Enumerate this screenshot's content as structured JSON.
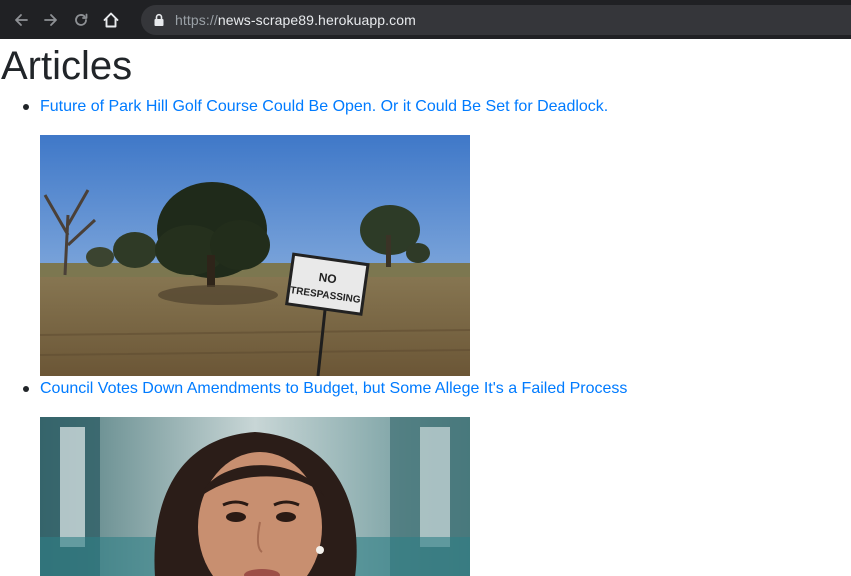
{
  "browser": {
    "url_scheme": "https://",
    "url_host": "news-scrape89.herokuapp.com",
    "icons": [
      "arrow-left-icon",
      "arrow-right-icon",
      "reload-icon",
      "home-icon",
      "lock-icon"
    ]
  },
  "page": {
    "heading": "Articles",
    "articles": [
      {
        "title": "Future of Park Hill Golf Course Could Be Open. Or it Could Be Set for Deadlock.",
        "image": "field-no-trespassing-sign",
        "sign_text": "NO TRESPASSING"
      },
      {
        "title": "Council Votes Down Amendments to Budget, but Some Allege It's a Failed Process",
        "image": "woman-portrait"
      }
    ]
  },
  "colors": {
    "link": "#007bff",
    "heading": "#212529",
    "toolbar": "#202124",
    "address_bar": "#35363a"
  }
}
